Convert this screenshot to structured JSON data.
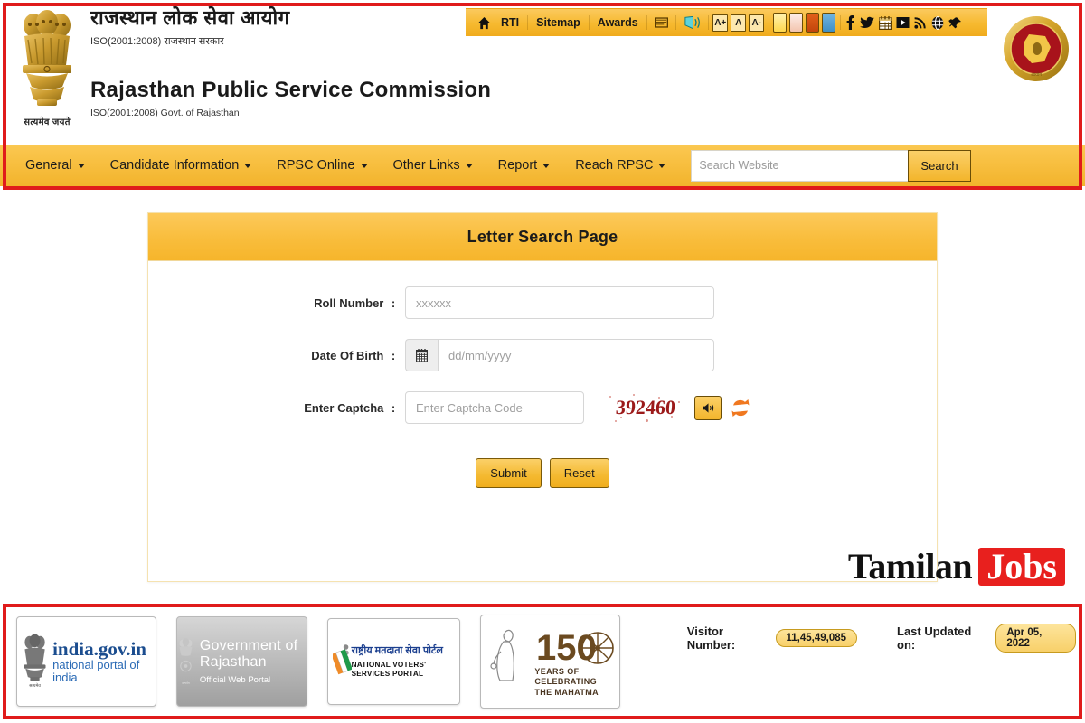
{
  "header": {
    "title_hindi": "राजस्थान लोक सेवा आयोग",
    "iso_hindi": "ISO(2001:2008) राजस्थान सरकार",
    "title_english": "Rajasthan Public Service Commission",
    "iso_english": "ISO(2001:2008) Govt. of Rajasthan",
    "emblem_caption": "सत्यमेव जयते",
    "emblem_name": "national-emblem-of-india",
    "logo_name": "rpsc-seal-logo"
  },
  "toolbar": {
    "home_label": "",
    "items": [
      {
        "label": "RTI",
        "name": "rti-link"
      },
      {
        "label": "Sitemap",
        "name": "sitemap-link"
      },
      {
        "label": "Awards",
        "name": "awards-link"
      }
    ],
    "icons": [
      "home-icon",
      "email-icon",
      "accessibility-icon"
    ],
    "font_size_buttons": [
      {
        "label": "A+",
        "name": "font-increase-button"
      },
      {
        "label": "A",
        "name": "font-normal-button"
      },
      {
        "label": "A-",
        "name": "font-decrease-button"
      }
    ],
    "theme_swatches": [
      {
        "name": "theme-swatch-yellow",
        "color": "#ffd84d"
      },
      {
        "name": "theme-swatch-pink",
        "color": "#f3c4ae"
      },
      {
        "name": "theme-swatch-orange",
        "color": "#c2450c"
      },
      {
        "name": "theme-swatch-blue",
        "color": "#3f8fc4"
      }
    ],
    "social_icons": [
      "facebook-icon",
      "twitter-icon",
      "calendar-icon",
      "youtube-icon",
      "rss-icon",
      "globe-icon",
      "pin-icon"
    ]
  },
  "nav": {
    "items": [
      {
        "label": "General",
        "has_caret": true
      },
      {
        "label": "Candidate Information",
        "has_caret": true
      },
      {
        "label": "RPSC Online",
        "has_caret": true
      },
      {
        "label": "Other Links",
        "has_caret": true
      },
      {
        "label": "Report",
        "has_caret": true
      },
      {
        "label": "Reach RPSC",
        "has_caret": true
      }
    ],
    "search_placeholder": "Search Website",
    "search_value": "",
    "search_button": "Search"
  },
  "panel": {
    "title": "Letter Search Page",
    "fields": {
      "roll_label": "Roll Number",
      "roll_placeholder": "xxxxxx",
      "roll_value": "",
      "dob_label": "Date Of Birth",
      "dob_placeholder": "dd/mm/yyyy",
      "dob_value": "",
      "captcha_label": "Enter Captcha",
      "captcha_placeholder": "Enter Captcha Code",
      "captcha_value": "",
      "colon": ":"
    },
    "captcha_code": "392460",
    "captcha_color": "#9c1a1a",
    "submit_label": "Submit",
    "reset_label": "Reset"
  },
  "watermark": {
    "part1": "Tamilan",
    "part2": "Jobs",
    "accent": "#e8201e"
  },
  "footer": {
    "logos": [
      {
        "name": "india-gov-in-logo",
        "line1": "india.gov.in",
        "line2": "national portal of india",
        "caption": "सत्यमेव जयते"
      },
      {
        "name": "government-of-rajasthan-logo",
        "line1": "Government of Rajasthan",
        "line2": "Official Web Portal"
      },
      {
        "name": "national-voters-services-portal-logo",
        "line1": "राष्ट्रीय मतदाता सेवा पोर्टल",
        "line2": "NATIONAL VOTERS' SERVICES PORTAL"
      },
      {
        "name": "mahatma-gandhi-150-years-logo",
        "line1": "YEARS OF",
        "line2": "CELEBRATING",
        "line3": "THE MAHATMA",
        "number": "150"
      }
    ],
    "visitor_label": "Visitor Number:",
    "visitor_value": "11,45,49,085",
    "updated_label": "Last Updated on:",
    "updated_value": "Apr 05, 2022"
  },
  "theme": {
    "gold": "#f7be3e",
    "red_frame": "#e01b1b",
    "panel_border": "#f5e2b0"
  }
}
